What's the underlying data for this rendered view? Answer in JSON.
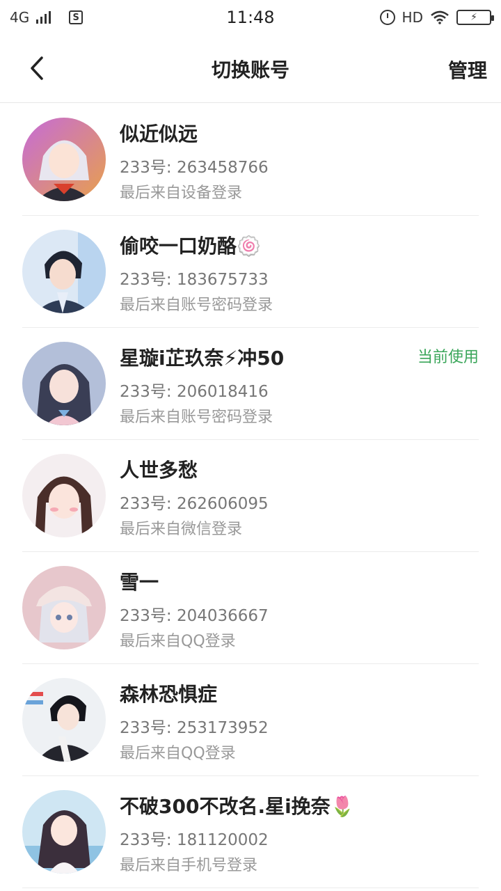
{
  "status_bar": {
    "network": "4G",
    "time": "11:48",
    "hd": "HD",
    "sim_label": "S"
  },
  "header": {
    "title": "切换账号",
    "manage_label": "管理"
  },
  "colors": {
    "accent_green": "#3aa65a",
    "divider": "#ececec"
  },
  "accounts": [
    {
      "name": "似近似远",
      "id": "233号: 263458766",
      "login": "最后来自设备登录",
      "current": ""
    },
    {
      "name": "偷咬一口奶酪🍥",
      "id": "233号: 183675733",
      "login": "最后来自账号密码登录",
      "current": ""
    },
    {
      "name": "星璇i芷玖奈⚡冲50",
      "id": "233号: 206018416",
      "login": "最后来自账号密码登录",
      "current": "当前使用"
    },
    {
      "name": "人世多愁",
      "id": "233号: 262606095",
      "login": "最后来自微信登录",
      "current": ""
    },
    {
      "name": "雪一",
      "id": "233号: 204036667",
      "login": "最后来自QQ登录",
      "current": ""
    },
    {
      "name": "森林恐惧症",
      "id": "233号: 253173952",
      "login": "最后来自QQ登录",
      "current": ""
    },
    {
      "name": "不破300不改名.星i挽奈🌷",
      "id": "233号: 181120002",
      "login": "最后来自手机号登录",
      "current": ""
    }
  ]
}
